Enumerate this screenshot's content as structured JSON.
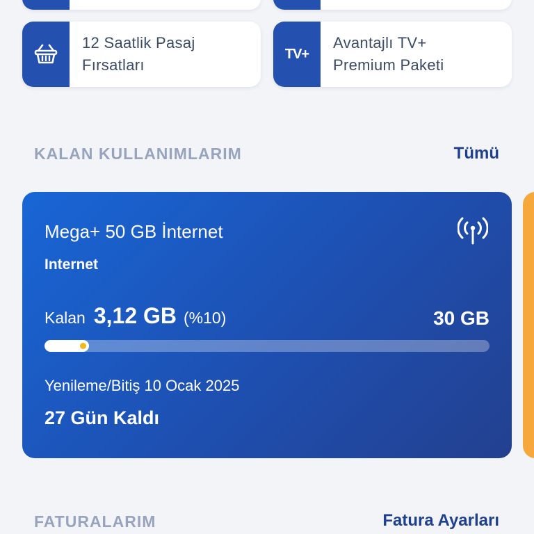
{
  "shortcuts": [
    {
      "label_line1": "",
      "label_line2": "",
      "icon": "unknown-icon"
    },
    {
      "label_line1": "",
      "label_line2": "",
      "icon": "unknown-icon"
    },
    {
      "label_line1": "12 Saatlik Pasaj",
      "label_line2": "Fırsatları",
      "icon": "basket-icon"
    },
    {
      "label_line1": "Avantajlı TV+",
      "label_line2": "Premium Paketi",
      "icon": "tv-plus-icon",
      "icon_text": "TV+"
    }
  ],
  "usage_section": {
    "title": "KALAN KULLANIMLARIM",
    "link": "Tümü"
  },
  "usage_card": {
    "package_name": "Mega+ 50 GB İnternet",
    "type": "Internet",
    "remaining_label": "Kalan",
    "remaining_value": "3,12 GB",
    "remaining_percent_text": "(%10)",
    "remaining_fraction": 0.1,
    "total": "30 GB",
    "renewal_text": "Yenileme/Bitiş 10 Ocak 2025",
    "days_left": "27 Gün Kaldı",
    "icon": "signal-tower-icon"
  },
  "bills_section": {
    "title": "FATURALARIM",
    "link": "Fatura Ayarları"
  },
  "colors": {
    "brand_blue": "#2450b0",
    "card_gradient_start": "#1866d6",
    "card_gradient_end": "#23408f",
    "accent_orange": "#f7a83c",
    "progress_dot": "#f2b81b"
  }
}
